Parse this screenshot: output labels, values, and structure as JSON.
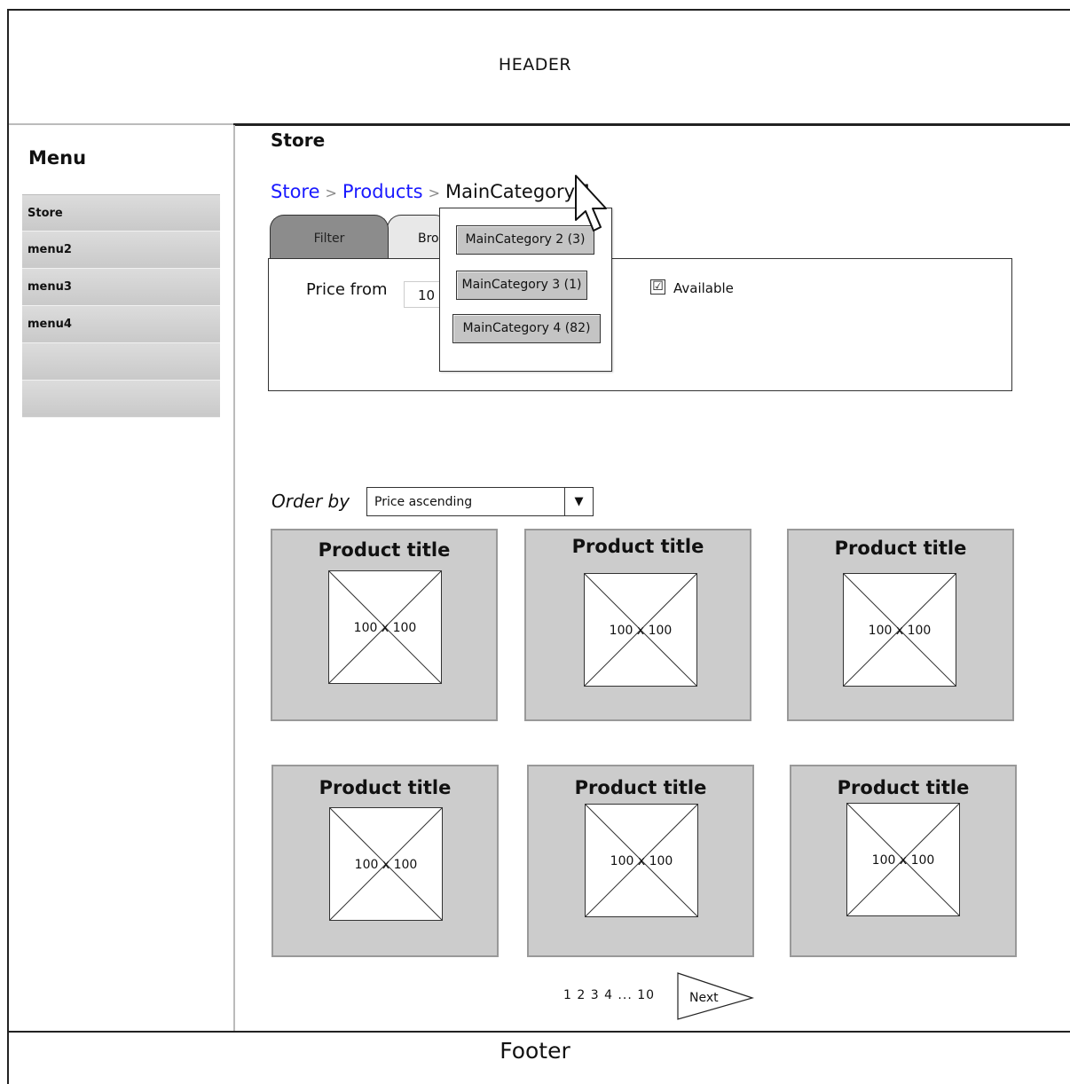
{
  "header": {
    "text": "HEADER"
  },
  "footer": {
    "text": "Footer"
  },
  "sidebar": {
    "heading": "Menu",
    "items": [
      {
        "label": "Store"
      },
      {
        "label": "menu2"
      },
      {
        "label": "menu3"
      },
      {
        "label": "menu4"
      },
      {
        "label": ""
      },
      {
        "label": ""
      }
    ]
  },
  "main": {
    "title": "Store",
    "breadcrumb": {
      "links": [
        "Store",
        "Products"
      ],
      "separator": ">",
      "current": "MainCategory 1"
    },
    "tabs": [
      {
        "label": "Filter",
        "active": true
      },
      {
        "label": "Bro"
      }
    ],
    "filter": {
      "price_label": "Price from",
      "price_from_value": "10",
      "available_label": "Available",
      "available_checked": "☑"
    },
    "category_dropdown": [
      "MainCategory 2 (3)",
      "MainCategory 3 (1)",
      "MainCategory 4 (82)"
    ],
    "order_by": {
      "label": "Order by",
      "value": "Price ascending",
      "arrow": "▼"
    },
    "products": [
      {
        "title": "Product title",
        "image_label": "100 x 100"
      },
      {
        "title": "Product title",
        "image_label": "100 x 100"
      },
      {
        "title": "Product title",
        "image_label": "100 x 100"
      },
      {
        "title": "Product title",
        "image_label": "100 x 100"
      },
      {
        "title": "Product title",
        "image_label": "100 x 100"
      },
      {
        "title": "Product title",
        "image_label": "100 x 100"
      }
    ],
    "pagination": {
      "pages": "1 2 3 4 ... 10",
      "next_label": "Next"
    }
  },
  "colors": {
    "link": "#1a1aff",
    "card_bg": "#cccccc",
    "active_tab": "#8c8c8c",
    "menu_item": "#d3d3d3"
  }
}
